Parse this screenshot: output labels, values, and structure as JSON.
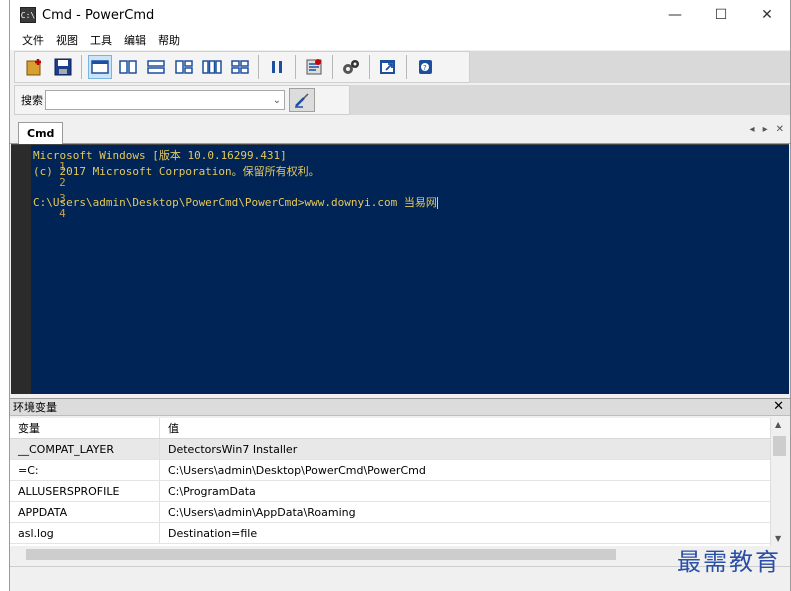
{
  "window": {
    "title": "Cmd - PowerCmd",
    "app_icon": "C:\\"
  },
  "menu": [
    "文件",
    "视图",
    "工具",
    "编辑",
    "帮助"
  ],
  "search": {
    "label": "搜索",
    "value": ""
  },
  "tabs": {
    "active": "Cmd"
  },
  "console": {
    "lines": [
      {
        "num": "1",
        "text": "Microsoft Windows [版本 10.0.16299.431]"
      },
      {
        "num": "2",
        "text": "(c) 2017 Microsoft Corporation。保留所有权利。"
      },
      {
        "num": "3",
        "text": ""
      },
      {
        "num": "4",
        "text": "C:\\Users\\admin\\Desktop\\PowerCmd\\PowerCmd>www.downyi.com 当易网"
      }
    ],
    "colors": {
      "background": "#012456",
      "text": "#e5c95a"
    }
  },
  "env_panel": {
    "title": "环境变量",
    "col_name": "变量",
    "col_value": "值",
    "rows": [
      {
        "name": "__COMPAT_LAYER",
        "value": "DetectorsWin7 Installer"
      },
      {
        "name": "=C:",
        "value": "C:\\Users\\admin\\Desktop\\PowerCmd\\PowerCmd"
      },
      {
        "name": "ALLUSERSPROFILE",
        "value": "C:\\ProgramData"
      },
      {
        "name": "APPDATA",
        "value": "C:\\Users\\admin\\AppData\\Roaming"
      },
      {
        "name": "asl.log",
        "value": "Destination=file"
      }
    ]
  },
  "watermark": "最需教育"
}
